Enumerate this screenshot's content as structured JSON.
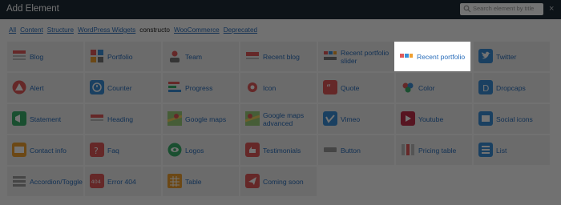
{
  "header": {
    "title": "Add Element",
    "search_placeholder": "Search element by title",
    "close_glyph": "×"
  },
  "filters": [
    {
      "label": "All",
      "current": false
    },
    {
      "label": "Content",
      "current": false
    },
    {
      "label": "Structure",
      "current": false
    },
    {
      "label": "WordPress Widgets",
      "current": false
    },
    {
      "label": "constructo",
      "current": true
    },
    {
      "label": "WooCommerce",
      "current": false
    },
    {
      "label": "Deprecated",
      "current": false
    }
  ],
  "elements": [
    {
      "label": "Blog",
      "icon": "blog-icon"
    },
    {
      "label": "Portfolio",
      "icon": "portfolio-icon"
    },
    {
      "label": "Team",
      "icon": "team-icon"
    },
    {
      "label": "Recent blog",
      "icon": "recent-blog-icon"
    },
    {
      "label": "Recent portfolio slider",
      "icon": "recent-portfolio-slider-icon"
    },
    {
      "label": "Recent portfolio",
      "icon": "recent-portfolio-icon",
      "active": true
    },
    {
      "label": "Twitter",
      "icon": "twitter-icon"
    },
    {
      "label": "Alert",
      "icon": "alert-icon"
    },
    {
      "label": "Counter",
      "icon": "counter-icon"
    },
    {
      "label": "Progress",
      "icon": "progress-icon"
    },
    {
      "label": "Icon",
      "icon": "icon-icon"
    },
    {
      "label": "Quote",
      "icon": "quote-icon"
    },
    {
      "label": "Color",
      "icon": "color-icon"
    },
    {
      "label": "Dropcaps",
      "icon": "dropcaps-icon"
    },
    {
      "label": "Statement",
      "icon": "statement-icon"
    },
    {
      "label": "Heading",
      "icon": "heading-icon"
    },
    {
      "label": "Google maps",
      "icon": "google-maps-icon"
    },
    {
      "label": "Google maps advanced",
      "icon": "google-maps-advanced-icon"
    },
    {
      "label": "Vimeo",
      "icon": "vimeo-icon"
    },
    {
      "label": "Youtube",
      "icon": "youtube-icon"
    },
    {
      "label": "Social icons",
      "icon": "social-icons-icon"
    },
    {
      "label": "Contact info",
      "icon": "contact-info-icon"
    },
    {
      "label": "Faq",
      "icon": "faq-icon"
    },
    {
      "label": "Logos",
      "icon": "logos-icon"
    },
    {
      "label": "Testimonials",
      "icon": "testimonials-icon"
    },
    {
      "label": "Button",
      "icon": "button-icon"
    },
    {
      "label": "Pricing table",
      "icon": "pricing-table-icon"
    },
    {
      "label": "List",
      "icon": "list-icon"
    },
    {
      "label": "Accordion/Toggle",
      "icon": "accordion-toggle-icon"
    },
    {
      "label": "Error 404",
      "icon": "error-404-icon"
    },
    {
      "label": "Table",
      "icon": "table-icon"
    },
    {
      "label": "Coming soon",
      "icon": "coming-soon-icon"
    }
  ]
}
